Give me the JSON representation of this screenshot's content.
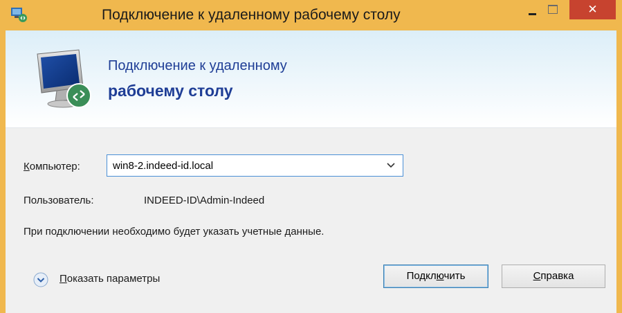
{
  "window": {
    "title": "Подключение к удаленному рабочему столу",
    "accent_color": "#f0b84e",
    "close_color": "#c7432f",
    "controls": {
      "minimize_icon": "minimize-icon",
      "maximize_icon": "maximize-icon",
      "close_glyph": "✕"
    }
  },
  "banner": {
    "line1": "Подключение к удаленному",
    "line2": "рабочему столу",
    "icon": "remote-desktop-monitor-icon"
  },
  "form": {
    "computer_label_hotkey": "К",
    "computer_label_rest": "омпьютер:",
    "computer_value": "win8-2.indeed-id.local",
    "user_label": "Пользователь:",
    "user_value": "INDEED-ID\\Admin-Indeed",
    "note": "При подключении необходимо будет указать учетные данные."
  },
  "footer": {
    "show_params_hotkey": "П",
    "show_params_rest": "оказать параметры",
    "connect_pre": "Подкл",
    "connect_hotkey": "ю",
    "connect_post": "чить",
    "help_hotkey": "С",
    "help_rest": "правка"
  }
}
